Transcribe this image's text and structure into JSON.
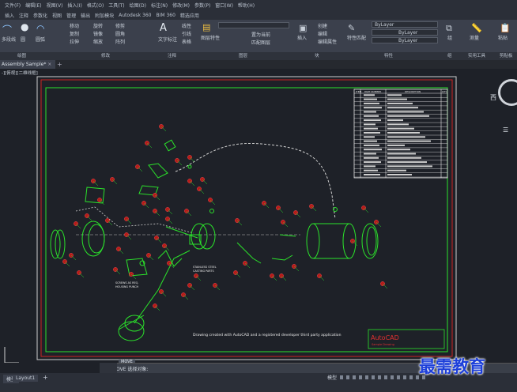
{
  "menu": [
    "文件(F)",
    "编辑(E)",
    "视图(V)",
    "插入(I)",
    "格式(O)",
    "工具(T)",
    "绘图(D)",
    "标注(N)",
    "修改(M)",
    "参数(P)",
    "窗口(W)",
    "帮助(H)"
  ],
  "ribbon_tabs": [
    "插入",
    "注释",
    "参数化",
    "视图",
    "管理",
    "输出",
    "附加模块",
    "Autodesk 360",
    "BIM 360",
    "精选应用"
  ],
  "ribbon": {
    "draw": {
      "line": "多段线",
      "circle": "圆",
      "arc": "圆弧"
    },
    "modify": {
      "move": "移动",
      "rotate": "旋转",
      "trim": "修剪",
      "copy": "复制",
      "mirror": "镜像",
      "fillet": "圆角",
      "stretch": "拉伸",
      "scale": "缩放",
      "array": "阵列"
    },
    "annotation": {
      "text": "文字",
      "dim": "标注",
      "linear": "线性",
      "leader": "引线",
      "table": "表格"
    },
    "layers": {
      "layer_props": "图层特性",
      "make_current": "置为当前",
      "match_layer": "匹配图层"
    },
    "block": {
      "insert": "插入",
      "create": "创建",
      "edit": "编辑",
      "attr": "编辑属性"
    },
    "properties": {
      "match": "特性匹配",
      "bylayer1": "ByLayer",
      "bylayer2": "ByLayer",
      "bylayer3": "ByLayer"
    },
    "groups": {
      "group": "组"
    },
    "utilities": {
      "measure": "测量"
    },
    "clipboard": {
      "paste": "粘贴"
    },
    "panels": [
      "绘图",
      "修改",
      "注释",
      "图层",
      "块",
      "特性",
      "组",
      "实用工具",
      "剪贴板"
    ]
  },
  "doc_tab": "Assembly Sample*",
  "viewport_label": "-][俯视][二维线框]",
  "viewcube": {
    "west": "西",
    "menu": "☰"
  },
  "drawing": {
    "note": "Drawing created with AutoCAD and a registered developer third party application",
    "title_logo": "AutoCAD",
    "title_sub": "Sample Drawing",
    "bom_headers": [
      "ITEM",
      "PART NUMBER",
      "DESCRIPTION",
      "QTY"
    ],
    "label_a": "SCREWS AS REQ.\nHOUSING PUNCH",
    "label_b": "STAINLESS STEEL\nCASTING PARTS"
  },
  "command": {
    "tooltip": "MOVE",
    "prompt": "× ▸ MOVE 选择对象:"
  },
  "layout_tabs": [
    "模型",
    "Layout1"
  ],
  "watermark": "最需教育"
}
